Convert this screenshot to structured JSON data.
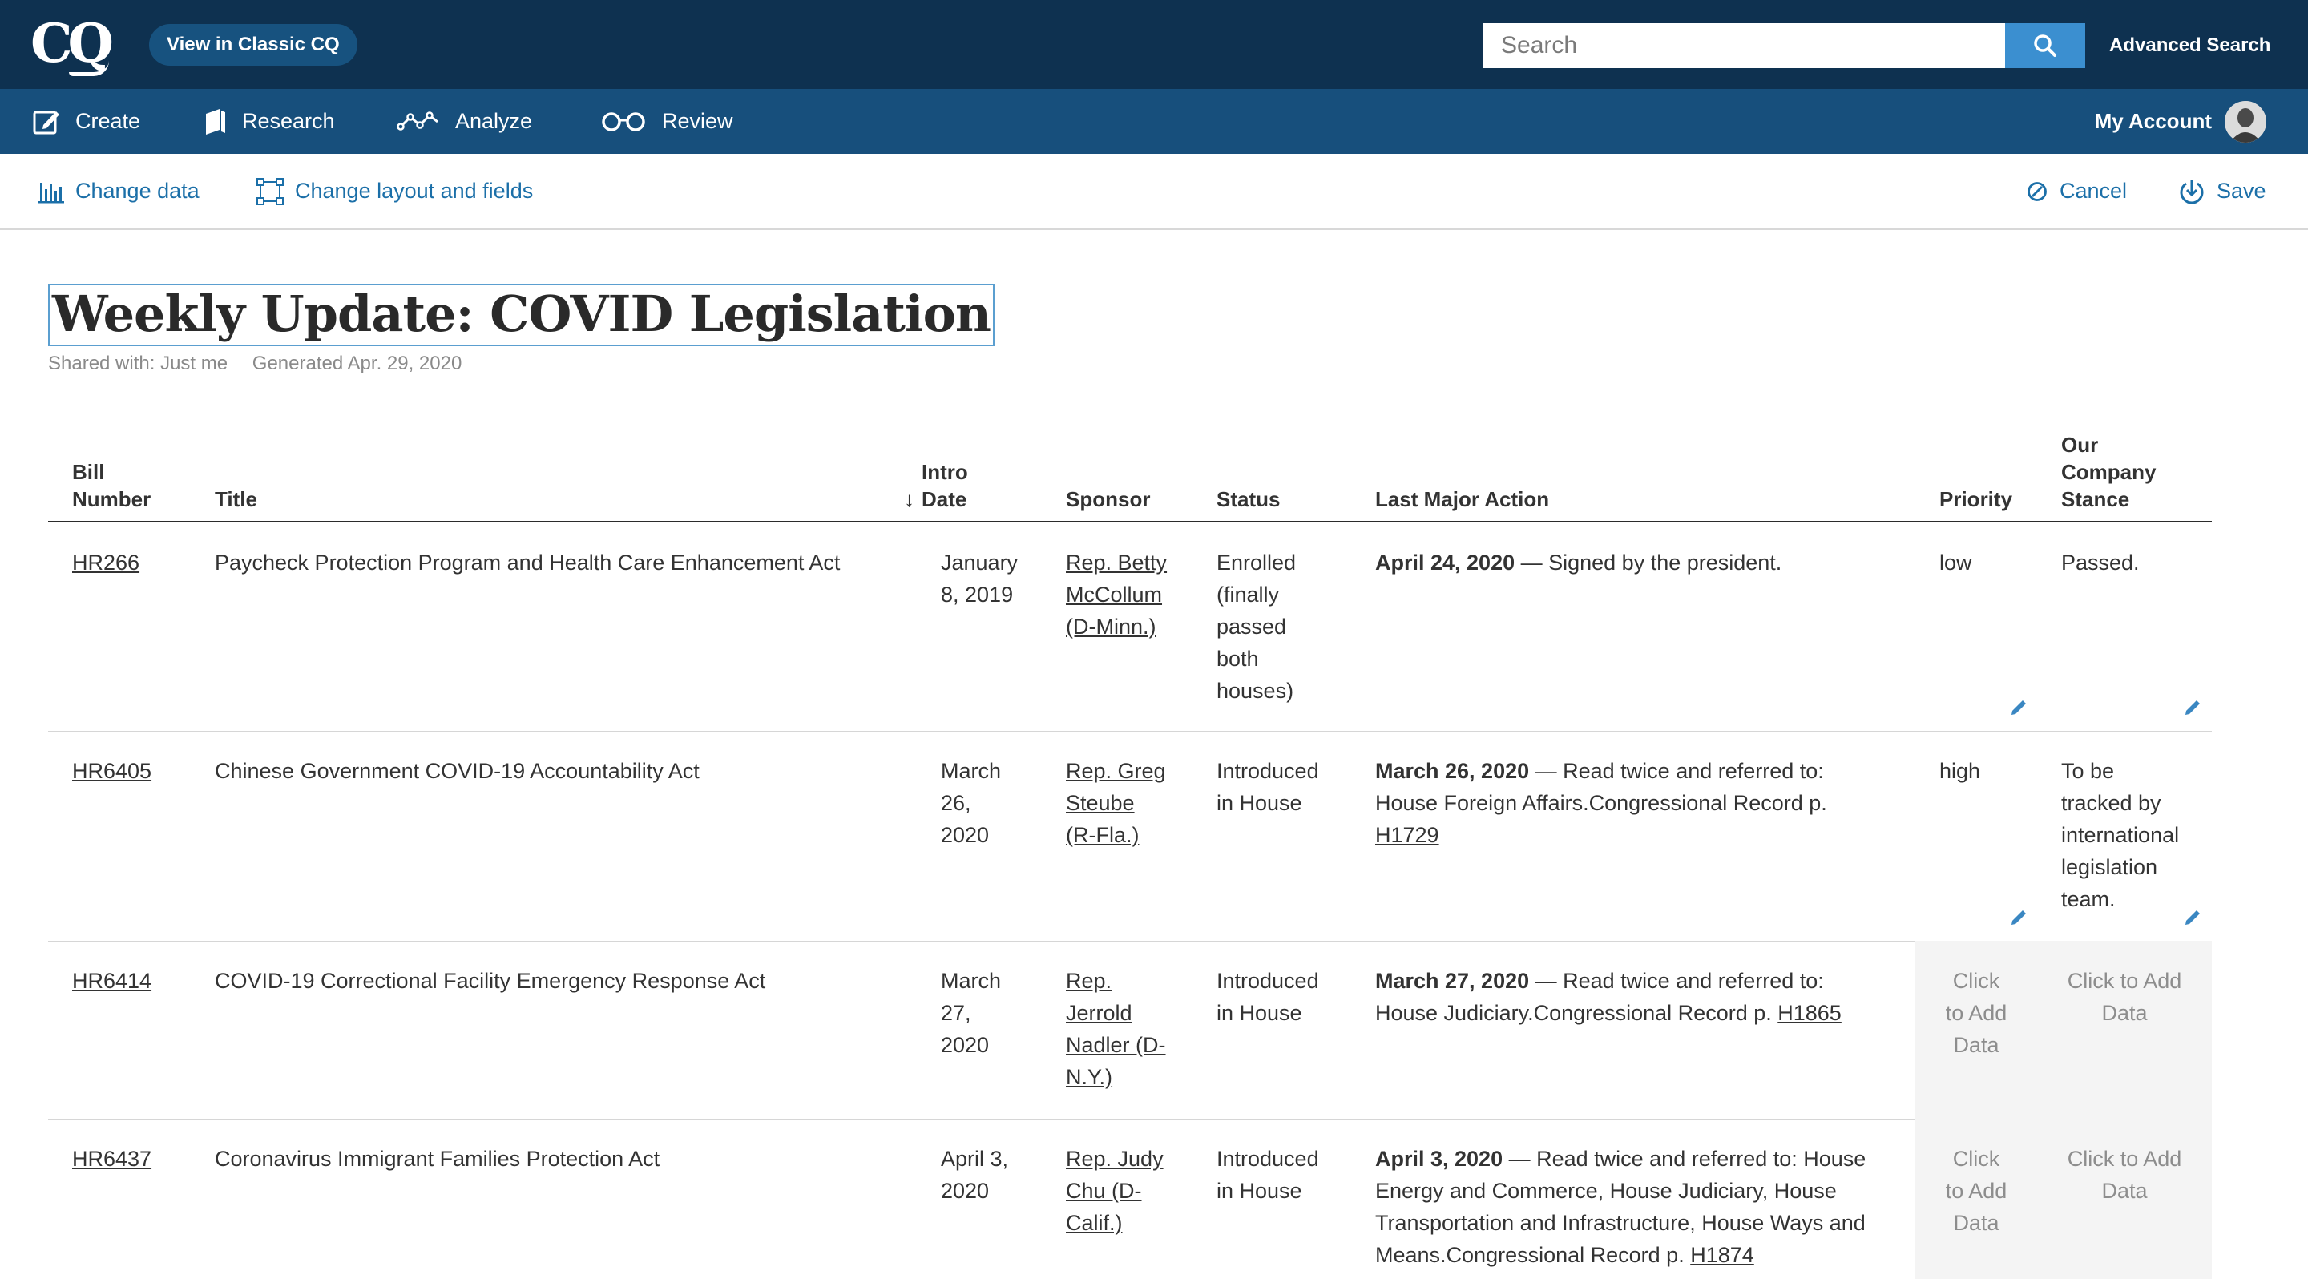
{
  "header": {
    "logo": "CQ",
    "classic_button": "View in Classic CQ",
    "search_placeholder": "Search",
    "advanced_search": "Advanced Search"
  },
  "nav": {
    "items": [
      {
        "label": "Create",
        "icon": "create-icon"
      },
      {
        "label": "Research",
        "icon": "research-icon"
      },
      {
        "label": "Analyze",
        "icon": "analyze-icon"
      },
      {
        "label": "Review",
        "icon": "review-icon"
      }
    ],
    "account_label": "My Account"
  },
  "toolbar": {
    "change_data": "Change data",
    "change_layout": "Change layout and fields",
    "cancel": "Cancel",
    "save": "Save"
  },
  "report": {
    "title": "Weekly Update: COVID Legislation",
    "shared_with": "Shared with: Just me",
    "generated": "Generated Apr. 29, 2020"
  },
  "table": {
    "headers": {
      "bill_number": [
        "Bill",
        "Number"
      ],
      "title": "Title",
      "intro_date": [
        "Intro",
        "Date"
      ],
      "sort_arrow": "↓",
      "sponsor": "Sponsor",
      "status": "Status",
      "last_major_action": "Last Major Action",
      "priority": "Priority",
      "stance": [
        "Our",
        "Company",
        "Stance"
      ]
    },
    "placeholder": "Click to Add Data",
    "rows": [
      {
        "bill": "HR266",
        "title": "Paycheck Protection Program and Health Care Enhancement Act",
        "intro_date": [
          "January",
          "8, 2019"
        ],
        "sponsor": [
          "Rep. Betty",
          "McCollum",
          "(D-Minn.)"
        ],
        "status": [
          "Enrolled",
          "(finally",
          "passed",
          "both",
          "houses)"
        ],
        "action_date": "April 24, 2020",
        "action_text": " — Signed by the president.",
        "action_lines": [],
        "action_link": "",
        "priority": "low",
        "stance": [
          "Passed."
        ]
      },
      {
        "bill": "HR6405",
        "title": "Chinese Government COVID-19 Accountability Act",
        "intro_date": [
          "March",
          "26,",
          "2020"
        ],
        "sponsor": [
          "Rep. Greg",
          "Steube",
          "(R-Fla.)"
        ],
        "status": [
          "Introduced",
          "in House"
        ],
        "action_date": "March 26, 2020",
        "action_text": " — Read twice and referred to:",
        "action_lines": [
          "House Foreign Affairs.Congressional Record p."
        ],
        "action_link": "H1729",
        "priority": "high",
        "stance": [
          "To be",
          "tracked by",
          "international",
          "legislation",
          "team."
        ]
      },
      {
        "bill": "HR6414",
        "title": "COVID-19 Correctional Facility Emergency Response Act",
        "intro_date": [
          "March",
          "27,",
          "2020"
        ],
        "sponsor": [
          "Rep.",
          "Jerrold",
          "Nadler (D-",
          "N.Y.)"
        ],
        "status": [
          "Introduced",
          "in House"
        ],
        "action_date": "March 27, 2020",
        "action_text": " — Read twice and referred to:",
        "action_lines": [
          "House Judiciary.Congressional Record p. "
        ],
        "action_link": "H1865",
        "priority_placeholder": [
          "Click",
          "to Add",
          "Data"
        ],
        "stance_placeholder": [
          "Click to Add",
          "Data"
        ]
      },
      {
        "bill": "HR6437",
        "title": "Coronavirus Immigrant Families Protection Act",
        "intro_date": [
          "April 3,",
          "2020"
        ],
        "sponsor": [
          "Rep. Judy",
          "Chu (D-",
          "Calif.)"
        ],
        "status": [
          "Introduced",
          "in House"
        ],
        "action_date": "April 3, 2020",
        "action_text": " — Read twice and referred to: House",
        "action_lines": [
          "Energy and Commerce, House Judiciary, House",
          "Transportation and Infrastructure, House Ways and",
          "Means.Congressional Record p. "
        ],
        "action_link": "H1874",
        "priority_placeholder": [
          "Click",
          "to Add",
          "Data"
        ],
        "stance_placeholder": [
          "Click to Add",
          "Data"
        ]
      }
    ]
  },
  "colors": {
    "topbar": "#0e3150",
    "navbar": "#174f7c",
    "accent": "#1b6fa8",
    "search_button": "#3b8fd0"
  }
}
